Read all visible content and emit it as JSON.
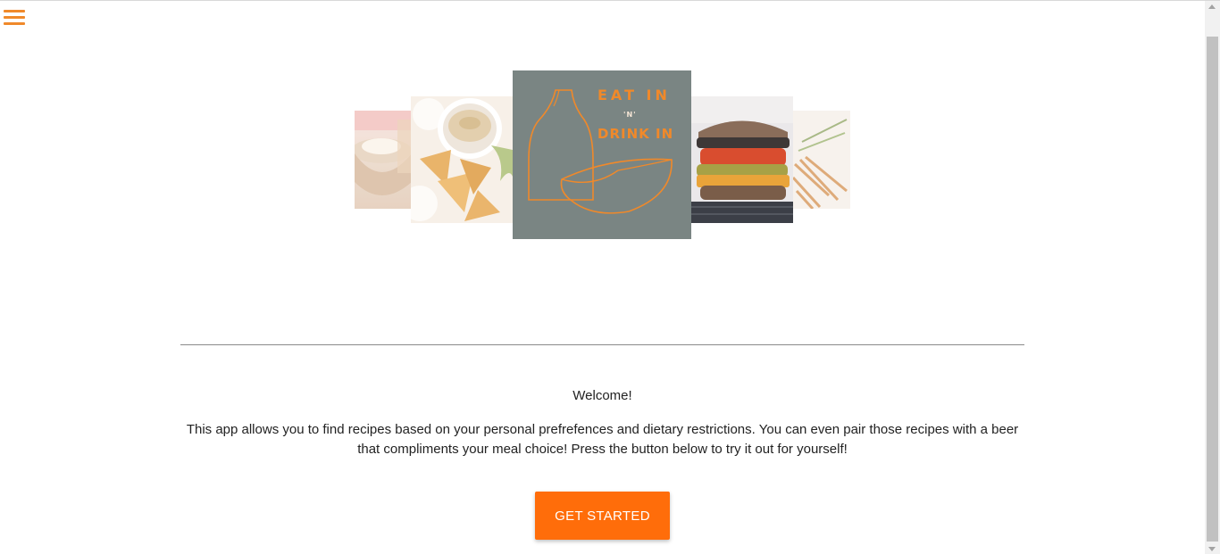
{
  "nav": {
    "menu_icon": "hamburger-menu-icon"
  },
  "logo": {
    "line1": "EAT IN",
    "line2": "'N'",
    "line3": "DRINK IN"
  },
  "carousel": {
    "cards": [
      {
        "name": "food-photo-bowl",
        "icon": "food-image"
      },
      {
        "name": "food-photo-hummus-chips",
        "icon": "food-image"
      },
      {
        "name": "logo-card",
        "icon": "bottle-bowl-logo"
      },
      {
        "name": "food-photo-burger",
        "icon": "food-image"
      },
      {
        "name": "food-photo-fries",
        "icon": "food-image"
      }
    ]
  },
  "main": {
    "welcome": "Welcome!",
    "intro": "This app allows you to find recipes based on your personal prefrefences and dietary restrictions. You can even pair those recipes with a beer that compliments your meal choice! Press the button below to try it out for yourself!",
    "cta_label": "Get Started"
  },
  "colors": {
    "accent": "#f0892a",
    "button": "#ff6d0a",
    "logo_bg": "#7a8583"
  }
}
